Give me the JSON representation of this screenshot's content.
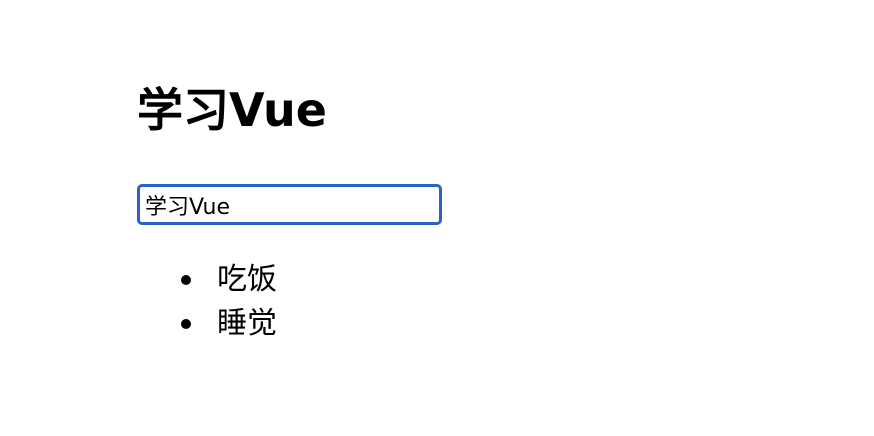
{
  "page": {
    "title": "学习Vue"
  },
  "input": {
    "value": "学习Vue",
    "border_color": "#2a62c7"
  },
  "todos": [
    {
      "label": "吃饭"
    },
    {
      "label": "睡觉"
    }
  ]
}
